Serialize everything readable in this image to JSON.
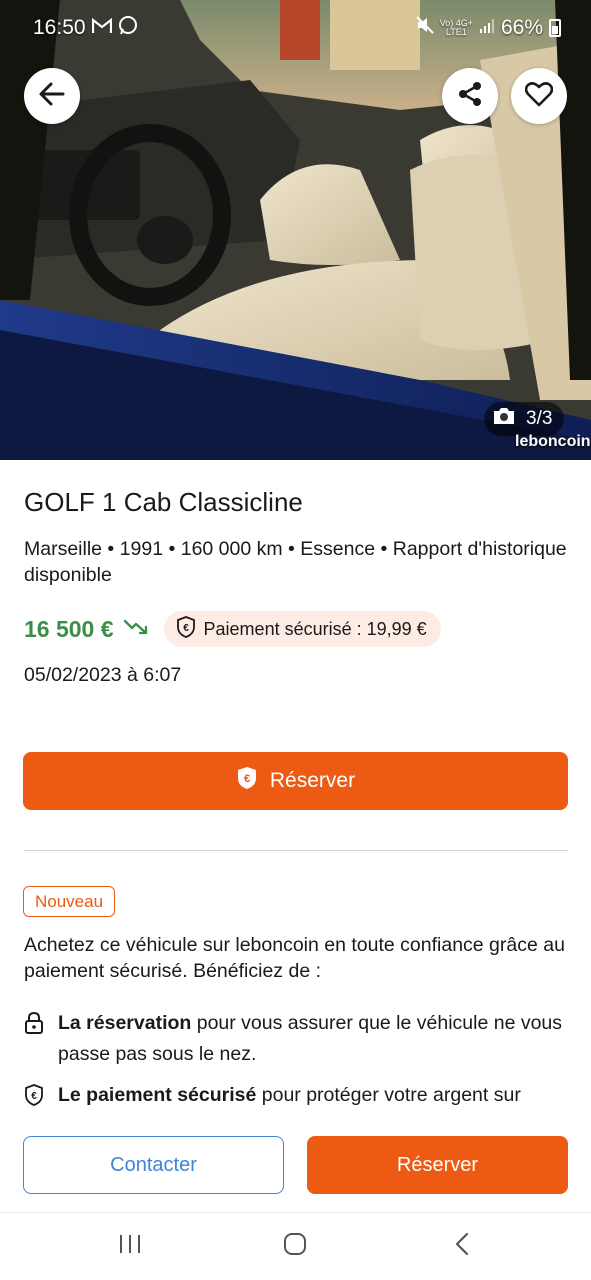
{
  "status_bar": {
    "time": "16:50",
    "app_icons": [
      "gmail-icon",
      "whatsapp-icon"
    ],
    "network_line1": "Vo) 4G+",
    "network_line2": "LTE1",
    "battery": "66%"
  },
  "gallery": {
    "counter": "3/3",
    "watermark": "leboncoin"
  },
  "listing": {
    "title": "GOLF 1 Cab Classicline",
    "meta": "Marseille • 1991 • 160 000 km • Essence • Rapport d'historique disponible",
    "price": "16 500 €",
    "secure_payment": "Paiement sécurisé : 19,99 €",
    "date": "05/02/2023 à 6:07"
  },
  "reserve": {
    "label": "Réserver"
  },
  "secure_section": {
    "badge": "Nouveau",
    "intro": "Achetez ce véhicule sur leboncoin en toute confiance grâce au paiement sécurisé. Bénéficiez de :",
    "benefits": [
      {
        "bold": "La réservation",
        "text": " pour vous assurer que le véhicule ne vous passe pas sous le nez."
      },
      {
        "bold": "Le paiement sécurisé",
        "text": " pour protéger votre argent sur leboncoin jusqu'à la remise du véhicule."
      }
    ]
  },
  "actions": {
    "contact": "Contacter",
    "reserve": "Réserver"
  },
  "colors": {
    "accent": "#ec5a13",
    "price": "#3a8f48",
    "link": "#4183d7"
  }
}
